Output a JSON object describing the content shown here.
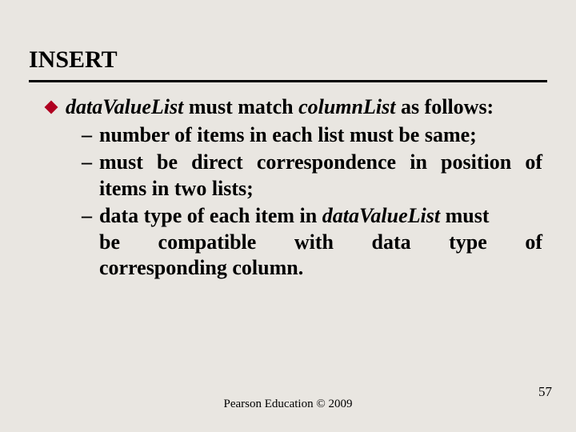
{
  "title": "INSERT",
  "lead": {
    "prefix_italic": "dataValueList",
    "middle_bold": " must match ",
    "mid_italic": "columnList",
    "suffix_bold": " as follows:"
  },
  "items": [
    {
      "text": "number of items in each list must be same;"
    },
    {
      "text": "must be direct correspondence in position of items in two lists;"
    },
    {
      "pre": "data type of each item in ",
      "italic": "dataValueList",
      "post_line1": " must",
      "line2": "be compatible with data type of",
      "line3": "corresponding column."
    }
  ],
  "footer": "Pearson Education © 2009",
  "page": "57"
}
